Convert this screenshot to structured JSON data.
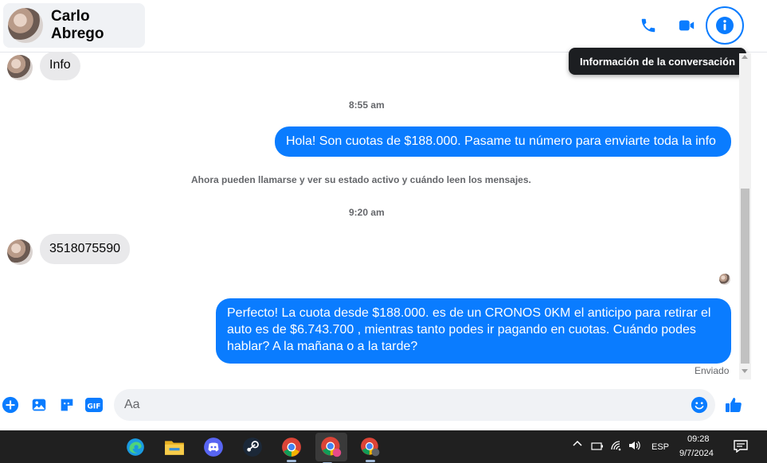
{
  "header": {
    "contact_name": "Carlo Abrego",
    "tooltip": "Información de la conversación"
  },
  "messages": {
    "info_bubble": "Info",
    "time_1": "8:55 am",
    "out_1": "Hola! Son cuotas de $188.000. Pasame tu número para enviarte toda la info",
    "notice": "Ahora pueden llamarse y ver su estado activo y cuándo leen los mensajes.",
    "time_2": "9:20 am",
    "in_phone": "3518075590",
    "out_2": "Perfecto! La cuota desde $188.000. es de un CRONOS 0KM el anticipo para retirar el auto es de $6.743.700 , mientras tanto podes ir pagando en cuotas. Cuándo podes hablar? A la mañana o a la tarde?",
    "status": "Enviado"
  },
  "composer": {
    "placeholder": "Aa"
  },
  "taskbar": {
    "language": "ESP",
    "time": "09:28",
    "date": "9/7/2024"
  },
  "colors": {
    "accent": "#0a7cff",
    "incoming_bubble": "#e9e9eb",
    "taskbar": "#202020"
  }
}
